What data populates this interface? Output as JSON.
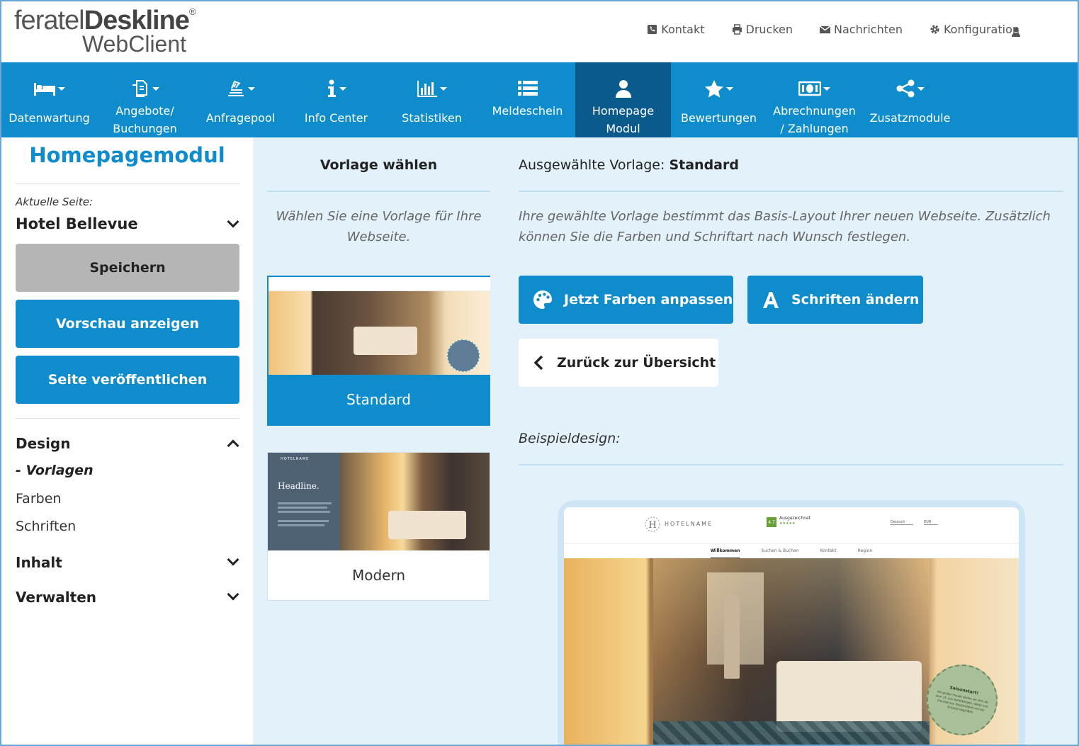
{
  "logo": {
    "brand_light": "feratel",
    "brand_bold": "Deskline",
    "reg": "®",
    "product": "WebClient"
  },
  "toplinks": [
    {
      "label": "Kontakt",
      "icon": "phone-icon"
    },
    {
      "label": "Drucken",
      "icon": "print-icon"
    },
    {
      "label": "Nachrichten",
      "icon": "envelope-icon"
    },
    {
      "label": "Konfiguration",
      "icon": "gear-icon"
    }
  ],
  "nav": [
    {
      "label": "Datenwartung",
      "icon": "bed-icon"
    },
    {
      "label": "Angebote/\nBuchungen",
      "icon": "documents-icon"
    },
    {
      "label": "Anfragepool",
      "icon": "stack-icon"
    },
    {
      "label": "Info Center",
      "icon": "info-icon"
    },
    {
      "label": "Statistiken",
      "icon": "bar-chart-icon"
    },
    {
      "label": "Meldeschein",
      "icon": "list-icon"
    },
    {
      "label": "Homepage\nModul",
      "icon": "user-icon"
    },
    {
      "label": "Bewertungen",
      "icon": "star-icon"
    },
    {
      "label": "Abrechnungen\n/ Zahlungen",
      "icon": "money-icon"
    },
    {
      "label": "Zusatzmodule",
      "icon": "share-icon"
    }
  ],
  "sidebar": {
    "title": "Homepagemodul",
    "current_label": "Aktuelle Seite:",
    "current_value": "Hotel Bellevue",
    "btn_save": "Speichern",
    "btn_preview": "Vorschau anzeigen",
    "btn_publish": "Seite veröffentlichen",
    "design": "Design",
    "vorlagen": "- Vorlagen",
    "farben": "Farben",
    "schriften": "Schriften",
    "inhalt": "Inhalt",
    "verwalten": "Verwalten"
  },
  "middle": {
    "title": "Vorlage wählen",
    "desc": "Wählen Sie eine Vorlage für Ihre Webseite.",
    "templates": [
      {
        "name": "Standard",
        "selected": true
      },
      {
        "name": "Modern",
        "selected": false,
        "headline": "Headline.",
        "brand": "HOTELNAME"
      }
    ]
  },
  "right": {
    "selected_label": "Ausgewählte Vorlage:",
    "selected_value": "Standard",
    "desc": "Ihre gewählte Vorlage bestimmt das Basis-Layout Ihrer neuen Webseite. Zusätzlich können Sie die Farben und Schriftart nach Wunsch festlegen.",
    "btn_colors": "Jetzt Farben anpassen",
    "btn_fonts": "Schriften ändern",
    "btn_back": "Zurück zur Übersicht",
    "example_label": "Beispieldesign:"
  },
  "preview": {
    "hotelname": "HOTELNAME",
    "rating": "4.7",
    "rating_label": "Ausgezeichnet",
    "lang": "Deutsch",
    "currency": "EUR",
    "menu": [
      "Willkommen",
      "Suchen & Buchen",
      "Kontakt",
      "Region"
    ],
    "seal_title": "Saisonstart!",
    "seal_text": "Mit großer Freude dürfen wir dich ab dem 15. Juni beherbergen, Gäste und Freunde aus Deutschland und der Schweiz begrüßen"
  },
  "colors": {
    "primary": "#0e8ccc",
    "nav_active": "#0a5a8c",
    "panel_bg": "#e3f1fa"
  }
}
